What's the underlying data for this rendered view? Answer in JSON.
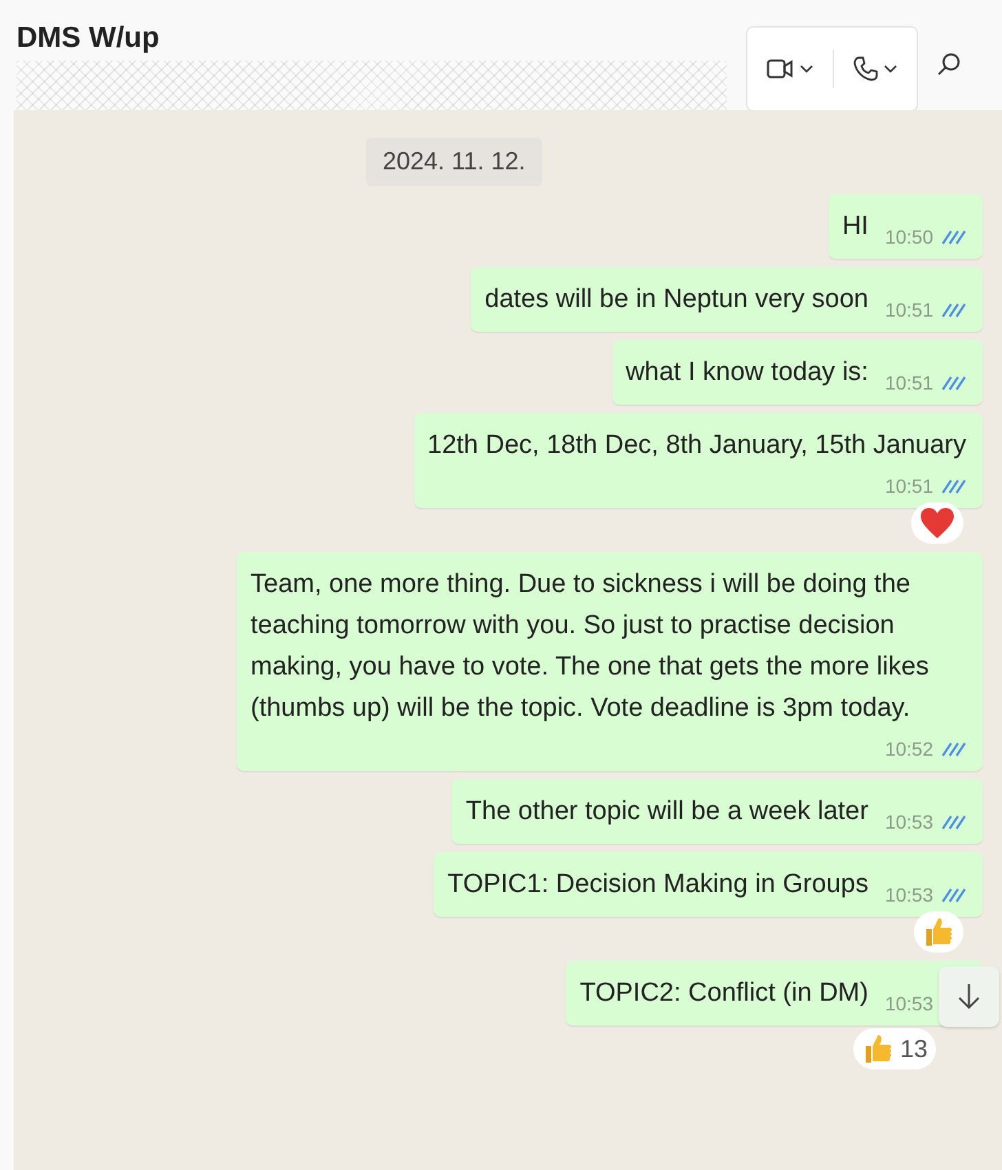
{
  "header": {
    "title": "DMS W/up",
    "call_buttons": [
      {
        "kind": "video"
      },
      {
        "kind": "voice"
      }
    ]
  },
  "date_chip": "2024. 11. 12.",
  "messages": [
    {
      "text": "HI",
      "time": "10:50",
      "ticks_shown": true,
      "time_below": false
    },
    {
      "text": "dates will be in Neptun very soon",
      "time": "10:51",
      "ticks_shown": true,
      "time_below": false
    },
    {
      "text": "what I know today is:",
      "time": "10:51",
      "ticks_shown": true,
      "time_below": false
    },
    {
      "text": "12th Dec, 18th Dec, 8th January, 15th January",
      "time": "10:51",
      "ticks_shown": true,
      "time_below": true,
      "reaction": {
        "kind": "heart"
      }
    },
    {
      "text": "Team, one more thing. Due to sickness i will be doing the teaching tomorrow with you. So just to practise decision making, you have to vote. The one that gets the more likes (thumbs up) will be the topic. Vote deadline is 3pm today.",
      "time": "10:52",
      "ticks_shown": true,
      "time_below": true
    },
    {
      "text": "The other topic will be a week later",
      "time": "10:53",
      "ticks_shown": true,
      "time_below": false
    },
    {
      "text": "TOPIC1: Decision Making in Groups",
      "time": "10:53",
      "ticks_shown": true,
      "time_below": false,
      "reaction": {
        "kind": "thumbs_up"
      }
    },
    {
      "text": "TOPIC2: Conflict (in DM)",
      "time": "10:53",
      "ticks_shown": false,
      "time_below": false,
      "reaction": {
        "kind": "thumbs_up",
        "count": "13"
      }
    }
  ]
}
